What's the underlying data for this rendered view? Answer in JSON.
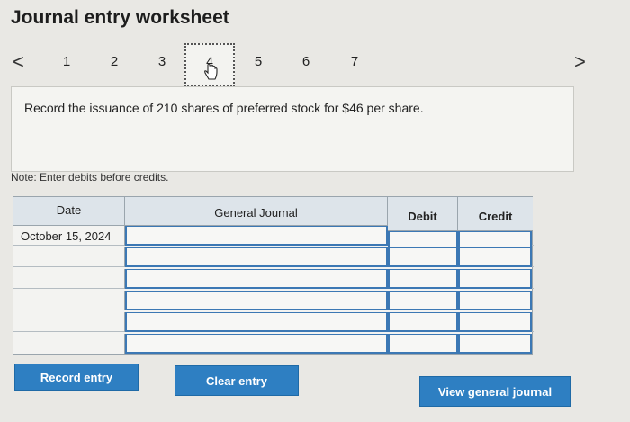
{
  "title": "Journal entry worksheet",
  "nav": {
    "prev_icon": "<",
    "next_icon": ">",
    "steps": [
      "1",
      "2",
      "3",
      "4",
      "5",
      "6",
      "7"
    ],
    "active_step": "4"
  },
  "prompt": "Record the issuance of 210 shares of preferred stock for $46 per share.",
  "note": "Note: Enter debits before credits.",
  "table": {
    "headers": {
      "date": "Date",
      "general_journal": "General Journal",
      "debit": "Debit",
      "credit": "Credit"
    },
    "rows": [
      {
        "date": "October 15, 2024",
        "account": "",
        "debit": "",
        "credit": ""
      },
      {
        "date": "",
        "account": "",
        "debit": "",
        "credit": ""
      },
      {
        "date": "",
        "account": "",
        "debit": "",
        "credit": ""
      },
      {
        "date": "",
        "account": "",
        "debit": "",
        "credit": ""
      },
      {
        "date": "",
        "account": "",
        "debit": "",
        "credit": ""
      },
      {
        "date": "",
        "account": "",
        "debit": "",
        "credit": ""
      }
    ]
  },
  "buttons": {
    "record": "Record entry",
    "clear": "Clear entry",
    "view": "View general journal"
  },
  "colors": {
    "accent": "#2e7fc2",
    "header_bg": "#dde4ea",
    "input_border": "#3c78b4"
  }
}
